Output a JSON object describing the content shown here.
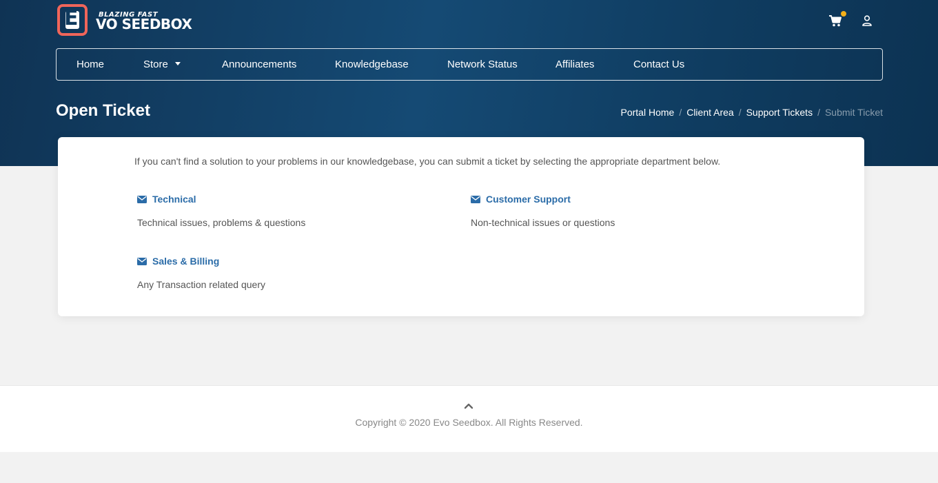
{
  "brand": {
    "tagline": "BLAZING FAST",
    "name": "VO SEEDBOX",
    "logo_letter": "E",
    "accent_color": "#f0655a",
    "header_color": "#154a74"
  },
  "header_icons": {
    "cart": "cart-icon",
    "user": "user-icon",
    "cart_badge_color": "#f4b019"
  },
  "nav": {
    "items": [
      {
        "label": "Home"
      },
      {
        "label": "Store",
        "has_dropdown": true
      },
      {
        "label": "Announcements"
      },
      {
        "label": "Knowledgebase"
      },
      {
        "label": "Network Status"
      },
      {
        "label": "Affiliates"
      },
      {
        "label": "Contact Us"
      }
    ]
  },
  "page": {
    "title": "Open Ticket"
  },
  "breadcrumb": {
    "items": [
      "Portal Home",
      "Client Area",
      "Support Tickets",
      "Submit Ticket"
    ],
    "separator": "/"
  },
  "main": {
    "intro": "If you can't find a solution to your problems in our knowledgebase, you can submit a ticket by selecting the appropriate department below.",
    "departments": [
      {
        "title": "Technical",
        "description": "Technical issues, problems & questions",
        "icon": "envelope-icon"
      },
      {
        "title": "Customer Support",
        "description": "Non-technical issues or questions",
        "icon": "envelope-icon"
      },
      {
        "title": "Sales & Billing",
        "description": "Any Transaction related query",
        "icon": "envelope-icon"
      }
    ],
    "link_color": "#2b6ca8"
  },
  "footer": {
    "copyright": "Copyright © 2020 Evo Seedbox. All Rights Reserved.",
    "back_to_top_icon": "chevron-up-icon"
  }
}
